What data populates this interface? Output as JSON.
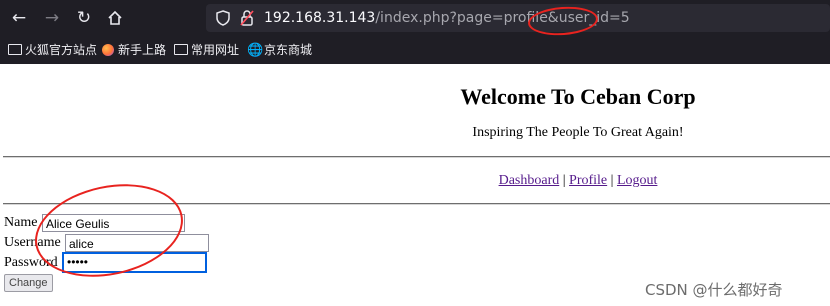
{
  "browser": {
    "nav": {
      "back_icon": "arrow-left-icon",
      "forward_icon": "arrow-right-icon",
      "reload_icon": "reload-icon",
      "home_icon": "home-icon"
    },
    "urlbar": {
      "host": "192.168.31.143",
      "path": "/index.php?page=profile&user_id=5",
      "shield_icon": "shield-icon",
      "insecure_lock_icon": "lock-warning-icon"
    },
    "bookmarks": [
      {
        "icon": "folder-icon",
        "label": "火狐官方站点"
      },
      {
        "icon": "firefox-icon",
        "label": "新手上路"
      },
      {
        "icon": "folder-icon",
        "label": "常用网址"
      },
      {
        "icon": "globe-icon",
        "label": "京东商城"
      }
    ]
  },
  "page": {
    "title": "Welcome To Ceban Corp",
    "tagline": "Inspiring The People To Great Again!",
    "nav": {
      "dashboard": "Dashboard",
      "profile": "Profile",
      "logout": "Logout",
      "separator": "|"
    },
    "form": {
      "name_label": "Name",
      "name_value": "Alice Geulis",
      "username_label": "Username",
      "username_value": "alice",
      "password_label": "Password",
      "password_value": "•••••",
      "submit_label": "Change"
    }
  },
  "watermark": "CSDN @什么都好奇",
  "colors": {
    "chrome_bg": "#1f1e25",
    "urlbar_bg": "#2b2a33",
    "link_visited": "#551a8b",
    "annotation_red": "#e8231f",
    "focus_blue": "#0060df"
  }
}
